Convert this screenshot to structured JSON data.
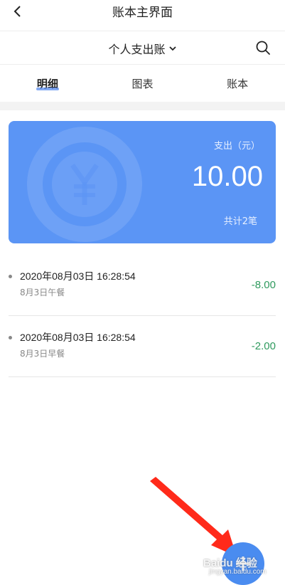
{
  "topbar": {
    "title": "账本主界面"
  },
  "book": {
    "name": "个人支出账"
  },
  "tabs": [
    {
      "label": "明细"
    },
    {
      "label": "图表"
    },
    {
      "label": "账本"
    }
  ],
  "summary": {
    "label": "支出（元）",
    "amount": "10.00",
    "count": "共计2笔"
  },
  "records": [
    {
      "time": "2020年08月03日 16:28:54",
      "note": "8月3日午餐",
      "amount": "-8.00"
    },
    {
      "time": "2020年08月03日 16:28:54",
      "note": "8月3日早餐",
      "amount": "-2.00"
    }
  ],
  "fab": {
    "label": "+"
  },
  "watermark": {
    "brand": "Baidu 经验",
    "url": "jingyan.baidu.com"
  },
  "colors": {
    "accent": "#5b95f5",
    "income_expense_green": "#2f9a5e",
    "arrow": "#ff2a1a"
  }
}
